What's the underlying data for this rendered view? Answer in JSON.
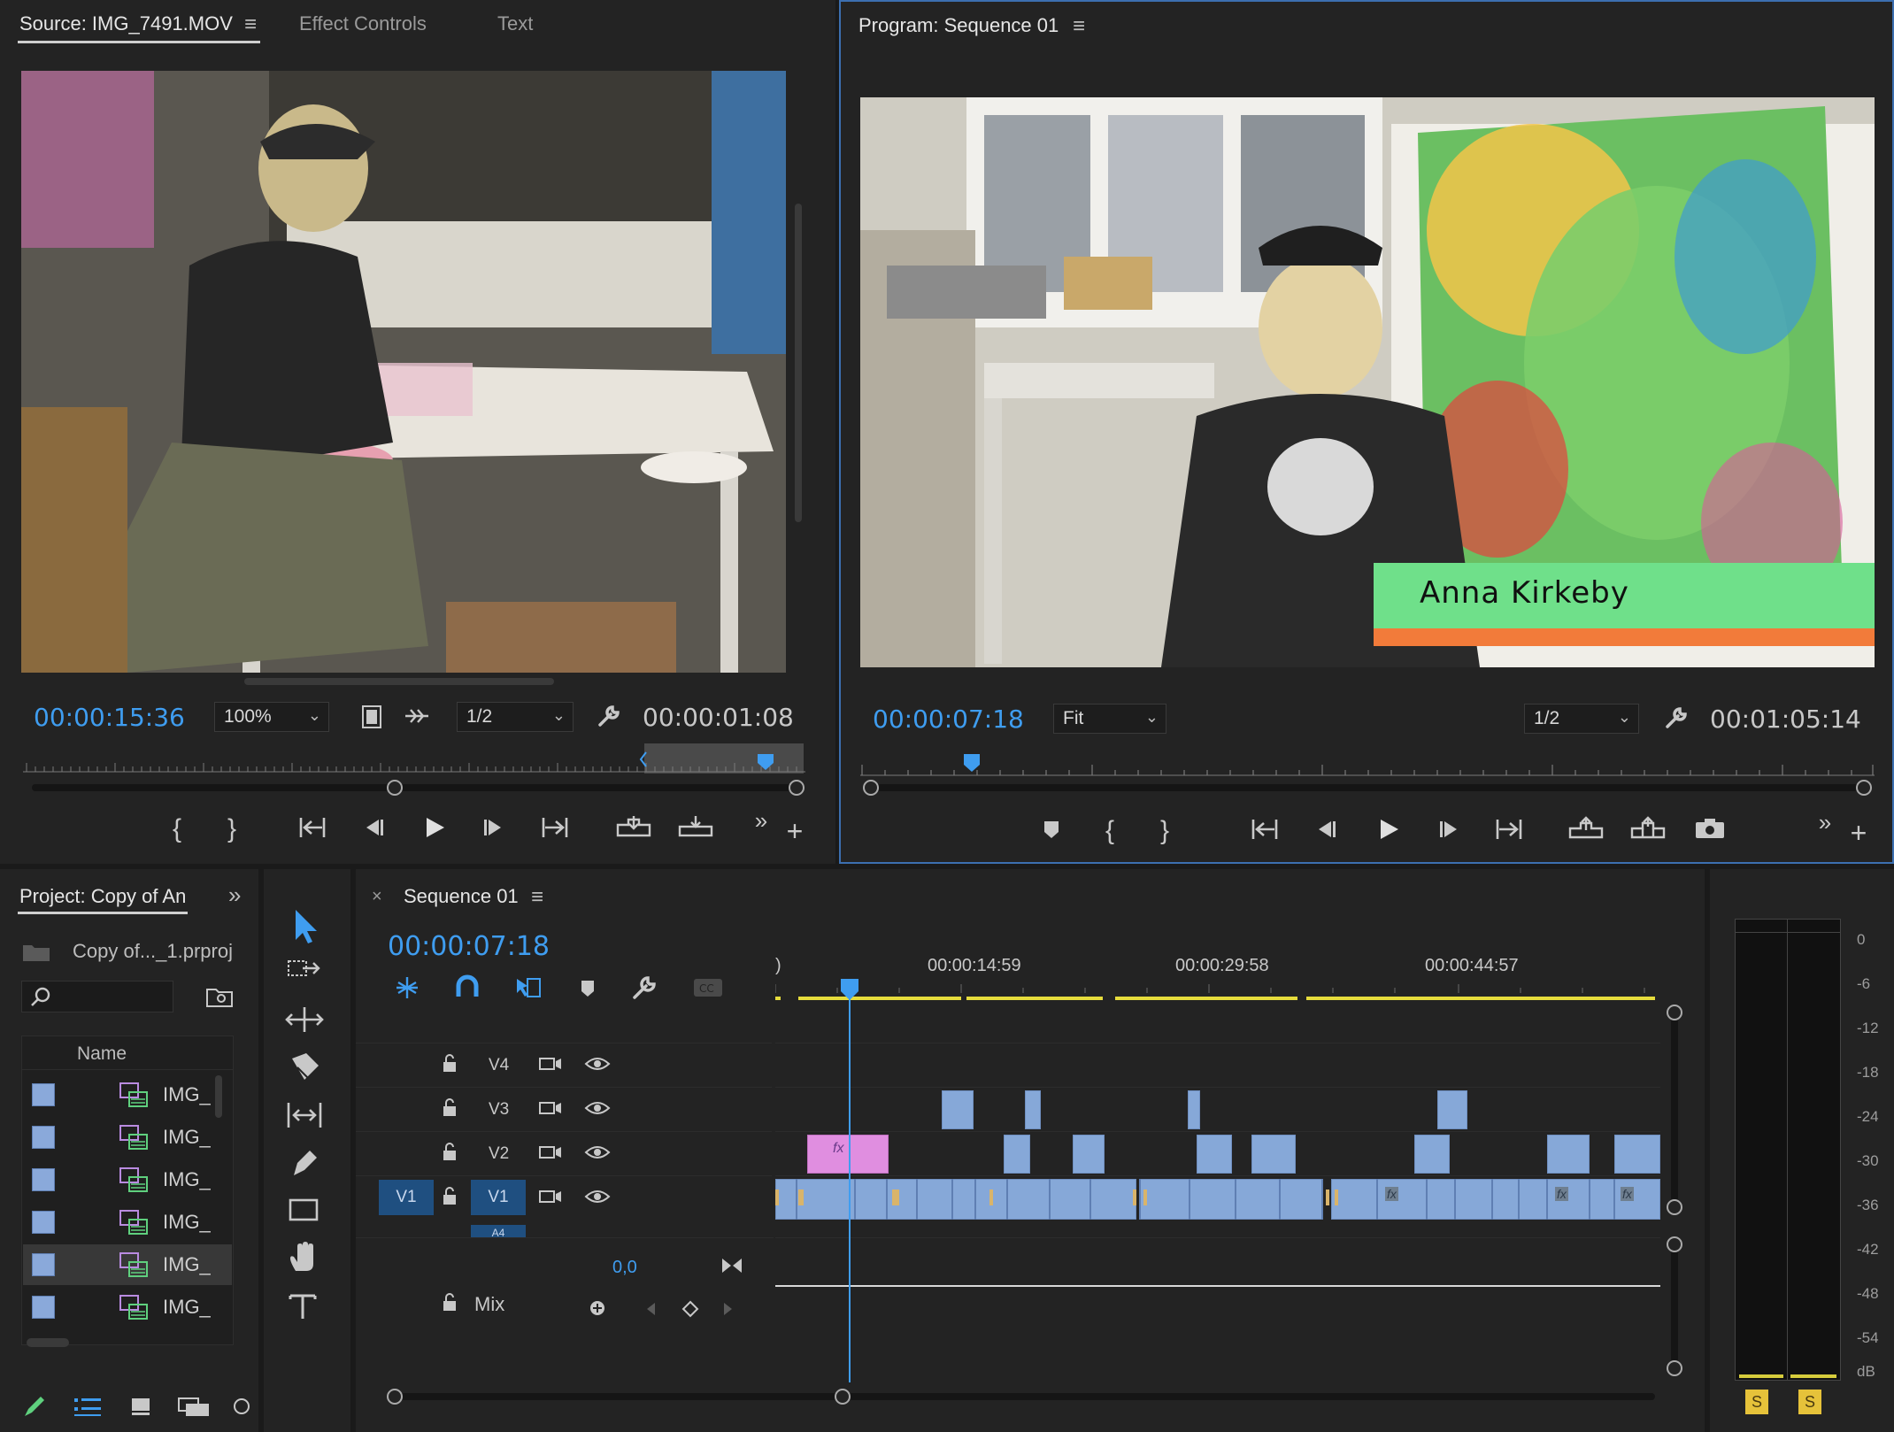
{
  "source_panel": {
    "tab_source": "Source: IMG_7491.MOV",
    "tab_effect_controls": "Effect Controls",
    "tab_text": "Text",
    "current_timecode": "00:00:15:36",
    "zoom": "100%",
    "resolution": "1/2",
    "duration": "00:00:01:08"
  },
  "program_panel": {
    "tab_program": "Program: Sequence 01",
    "current_timecode": "00:00:07:18",
    "zoom": "Fit",
    "resolution": "1/2",
    "duration": "00:01:05:14",
    "lower_third_name": "Anna Kirkeby"
  },
  "project_panel": {
    "tab_project": "Project: Copy of An",
    "project_file": "Copy of..._1.prproj",
    "search_placeholder": "",
    "column_name": "Name",
    "items": [
      {
        "name": "IMG_"
      },
      {
        "name": "IMG_"
      },
      {
        "name": "IMG_"
      },
      {
        "name": "IMG_"
      },
      {
        "name": "IMG_"
      },
      {
        "name": "IMG_"
      }
    ]
  },
  "timeline": {
    "tab_sequence": "Sequence 01",
    "current_timecode": "00:00:07:18",
    "ruler_start": ")",
    "ruler_labels": [
      "00:00:14:59",
      "00:00:29:58",
      "00:00:44:57"
    ],
    "tracks": {
      "v4": "V4",
      "v3": "V3",
      "v2": "V2",
      "v1": "V1",
      "v1_source": "V1",
      "a4": "A4"
    },
    "mix_label": "Mix",
    "mix_value": "0,0",
    "fx_label": "fx"
  },
  "audio_meter": {
    "scale": [
      "0",
      "-6",
      "-12",
      "-18",
      "-24",
      "-30",
      "-36",
      "-42",
      "-48",
      "-54",
      "dB"
    ],
    "solo_left": "S",
    "solo_right": "S"
  },
  "colors": {
    "accent_blue": "#3f9df0",
    "clip_blue": "#86a8d8",
    "clip_pink": "#e08ee0",
    "lower_third_green": "#6fe08a",
    "lower_third_orange": "#f27b3a",
    "work_area_yellow": "#e6dc3c"
  }
}
